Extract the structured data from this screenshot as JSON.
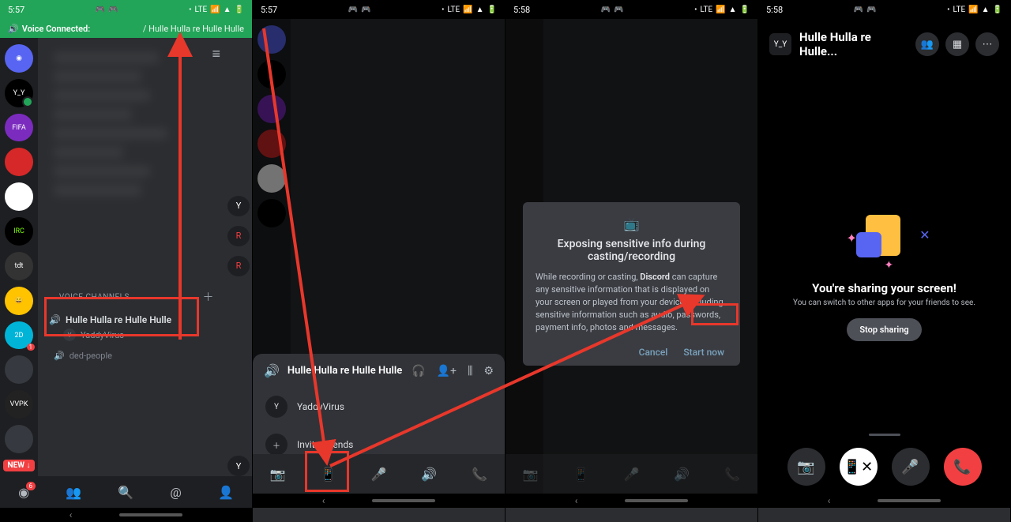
{
  "screen1": {
    "time": "5:57",
    "voice_connected": "Voice Connected:",
    "voice_path": "/ Hulle Hulla re Hulle Hulle",
    "servers": [
      "",
      "Y_Y",
      "FIFA",
      "",
      "",
      "IRC",
      "tdt",
      "😄",
      "2D",
      "",
      "VVPK",
      ""
    ],
    "new_label": "NEW ↓",
    "vc_header": "VOICE CHANNELS",
    "vc_channel": "Hulle Hulla re Hulle Hulle",
    "vc_user": "YaddyVirus",
    "ded_channel": "ded-people",
    "bottom_nav_badge": "6"
  },
  "screen2": {
    "time": "5:57",
    "sheet": {
      "title": "Hulle Hulla re Hulle Hulle",
      "user": "YaddyVirus",
      "invite": "Invite Friends"
    }
  },
  "screen3": {
    "time": "5:58",
    "modal": {
      "title": "Exposing sensitive info during casting/recording",
      "body_pre": "While recording or casting, ",
      "body_app": "Discord",
      "body_post": " can capture any sensitive information that is displayed on your screen or played from your device, including sensitive information such as audio, passwords, payment info, photos and messages.",
      "cancel": "Cancel",
      "start": "Start now"
    }
  },
  "screen4": {
    "time": "5:58",
    "title": "Hulle Hulla re Hulle...",
    "share_title": "You're sharing your screen!",
    "share_sub": "You can switch to other apps for your friends to see.",
    "stop": "Stop sharing"
  }
}
